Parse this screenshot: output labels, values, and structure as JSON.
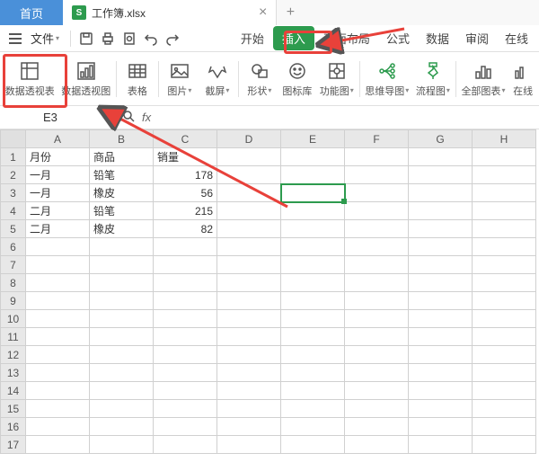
{
  "titlebar": {
    "home_tab": "首页",
    "doc_name": "工作簿.xlsx",
    "doc_icon_letter": "S",
    "close_glyph": "×",
    "new_tab_glyph": "+"
  },
  "file_row": {
    "file_label": "文件",
    "qa_icons": [
      "save-icon",
      "print-icon",
      "print-preview-icon",
      "undo-icon",
      "redo-icon"
    ]
  },
  "menu_tabs": {
    "start": "开始",
    "insert": "插入",
    "page_layout_partial": "页面布局",
    "formula": "公式",
    "data": "数据",
    "review": "审阅",
    "more_partial": "在线"
  },
  "ribbon": {
    "pivot_table": "数据透视表",
    "pivot_chart": "数据透视图",
    "table": "表格",
    "picture": "图片",
    "screenshot": "截屏",
    "shape": "形状",
    "icon_lib": "图标库",
    "smartart": "功能图",
    "mindmap": "思维导图",
    "flowchart": "流程图",
    "all_charts": "全部图表",
    "online_partial": "在线"
  },
  "formula_bar": {
    "name_box": "E3",
    "fx": "fx"
  },
  "columns": [
    "A",
    "B",
    "C",
    "D",
    "E",
    "F",
    "G",
    "H"
  ],
  "rows": [
    1,
    2,
    3,
    4,
    5,
    6,
    7,
    8,
    9,
    10,
    11,
    12,
    13,
    14,
    15,
    16,
    17
  ],
  "table_data": {
    "headers": [
      "月份",
      "商品",
      "销量"
    ],
    "rows": [
      {
        "month": "一月",
        "product": "铅笔",
        "sales": 178
      },
      {
        "month": "一月",
        "product": "橡皮",
        "sales": 56
      },
      {
        "month": "二月",
        "product": "铅笔",
        "sales": 215
      },
      {
        "month": "二月",
        "product": "橡皮",
        "sales": 82
      }
    ]
  },
  "selected_cell": "E3",
  "chart_data": {
    "type": "table",
    "title": "",
    "columns": [
      "月份",
      "商品",
      "销量"
    ],
    "rows": [
      [
        "一月",
        "铅笔",
        178
      ],
      [
        "一月",
        "橡皮",
        56
      ],
      [
        "二月",
        "铅笔",
        215
      ],
      [
        "二月",
        "橡皮",
        82
      ]
    ]
  }
}
